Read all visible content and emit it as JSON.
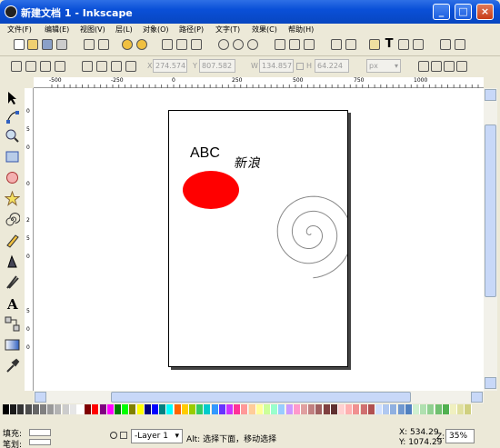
{
  "window": {
    "title": "新建文档 1 - Inkscape",
    "minimize": "_",
    "maximize": "□",
    "close": "×"
  },
  "menu": [
    "文件(F)",
    "编辑(E)",
    "视图(V)",
    "层(L)",
    "对象(O)",
    "路径(P)",
    "文字(T)",
    "效果(C)",
    "帮助(H)"
  ],
  "toolbar2": {
    "x_label": "X",
    "x_value": "274.574",
    "y_label": "Y",
    "y_value": "807.582",
    "w_label": "W",
    "w_value": "134.857",
    "h_label": "H",
    "h_value": "64.224",
    "unit": "px"
  },
  "ruler_top": [
    "-500",
    "-250",
    "0",
    "250",
    "500",
    "750",
    "1000"
  ],
  "ruler_left": [
    "0",
    "5",
    "0",
    "0",
    "2",
    "5",
    "0",
    "5",
    "0",
    "0"
  ],
  "canvas": {
    "text_abc": "ABC",
    "text_cn": "新浪",
    "ellipse_color": "#ff0000"
  },
  "palette_colors": [
    "#000000",
    "#1a1a1a",
    "#333333",
    "#4d4d4d",
    "#666666",
    "#808080",
    "#999999",
    "#b3b3b3",
    "#cccccc",
    "#e6e6e6",
    "#ffffff",
    "#800000",
    "#ff0000",
    "#800080",
    "#ff00ff",
    "#008000",
    "#00ff00",
    "#808000",
    "#ffff00",
    "#000080",
    "#0000ff",
    "#008080",
    "#00ffff",
    "#ff6600",
    "#ffcc00",
    "#99cc00",
    "#33cc66",
    "#00cccc",
    "#3399ff",
    "#6633ff",
    "#cc33ff",
    "#ff3399",
    "#ff9999",
    "#ffcc99",
    "#ffff99",
    "#ccff99",
    "#99ffcc",
    "#99ccff",
    "#cc99ff",
    "#ff99cc",
    "#e0a0a0",
    "#c08080",
    "#a06060",
    "#804040",
    "#603030",
    "#ffd0d0",
    "#ffb0b0",
    "#f09090",
    "#d07070",
    "#b05050",
    "#d0e0ff",
    "#b0c8f0",
    "#90b0e0",
    "#7098d0",
    "#5080c0",
    "#d0f0d0",
    "#b0e0b0",
    "#90d090",
    "#70c070",
    "#50b050",
    "#f0f0c0",
    "#e0e0a0",
    "#d0d080"
  ],
  "status": {
    "fill_label": "填充:",
    "stroke_label": "笔划:",
    "layer": "-Layer 1",
    "message": "Alt: 选择下面，移动选择",
    "x_coord": "X: 534.29",
    "y_coord": "Y: 1074.29",
    "zoom_label": "Z:",
    "zoom_value": "35%"
  }
}
